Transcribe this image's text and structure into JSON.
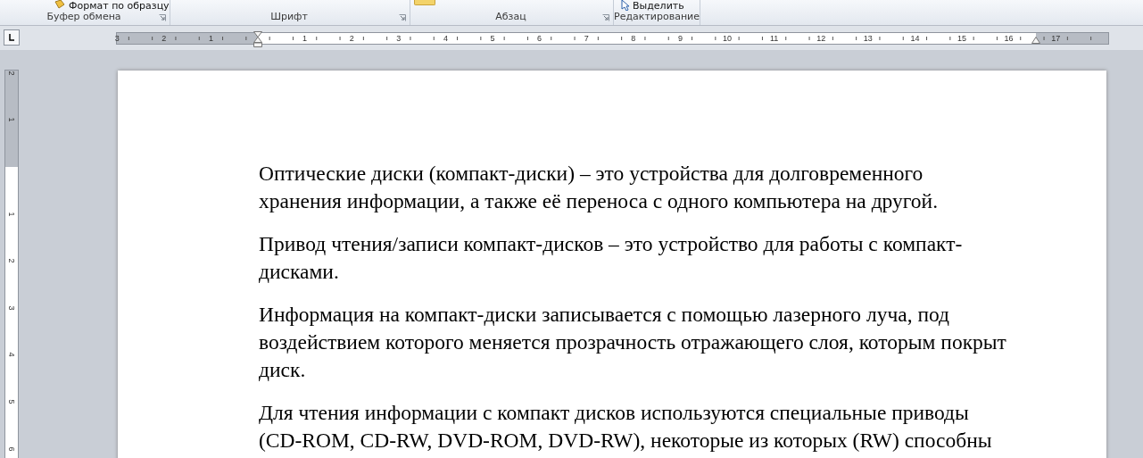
{
  "ribbon": {
    "clipboard": {
      "button": "Формат по образцу",
      "label": "Буфер обмена",
      "launcher": true
    },
    "groups": [
      {
        "label": "Шрифт",
        "launcher": true
      },
      {
        "label": "Абзац",
        "launcher": true
      },
      {
        "label": "Редактирование"
      }
    ],
    "select_button": "Выделить"
  },
  "horizontal_ruler": {
    "left_labels": [
      "3",
      "2",
      "1"
    ],
    "right_labels": [
      "1",
      "2",
      "3",
      "4",
      "5",
      "6",
      "7",
      "8",
      "9",
      "10",
      "11",
      "12",
      "13",
      "14",
      "15",
      "16",
      "17"
    ]
  },
  "vertical_ruler": {
    "top_labels": [
      "2",
      "1"
    ],
    "body_labels": [
      "1",
      "2",
      "3",
      "4",
      "5",
      "6"
    ]
  },
  "document": {
    "paragraphs": [
      "Оптические диски (компакт-диски) – это устройства для долговременного хранения информации, а также её переноса с одного компьютера на другой.",
      "Привод чтения/записи компакт-дисков – это устройство для работы с компакт-дисками.",
      "Информация на компакт-диски записывается с помощью лазерного луча, под воздействием которого меняется прозрачность отражающего слоя, которым покрыт диск.",
      "Для чтения информации с компакт дисков используются специальные приводы (CD-ROM, CD-RW, DVD-ROM, DVD-RW), некоторые из которых (RW) способны"
    ]
  }
}
